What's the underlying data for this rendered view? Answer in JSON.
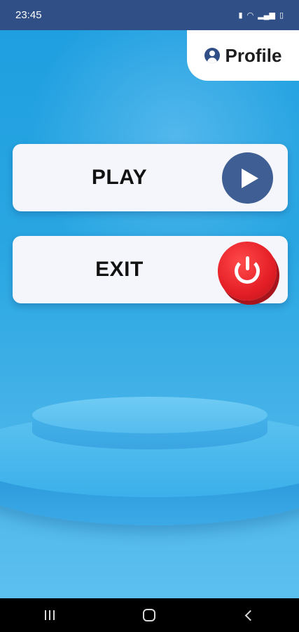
{
  "status_bar": {
    "time": "23:45",
    "icons": [
      "battery-saver-icon",
      "wifi-icon",
      "signal-icon",
      "battery-icon"
    ]
  },
  "profile": {
    "label": "Profile",
    "icon": "user-circle-icon"
  },
  "menu": {
    "play_label": "PLAY",
    "exit_label": "EXIT"
  },
  "colors": {
    "status_bar": "#2f4f86",
    "play_circle": "#3f5f94",
    "exit_circle": "#e41e26",
    "button_bg": "#f5f6fb"
  },
  "nav_bar": {
    "buttons": [
      "recents-icon",
      "home-icon",
      "back-icon"
    ]
  }
}
